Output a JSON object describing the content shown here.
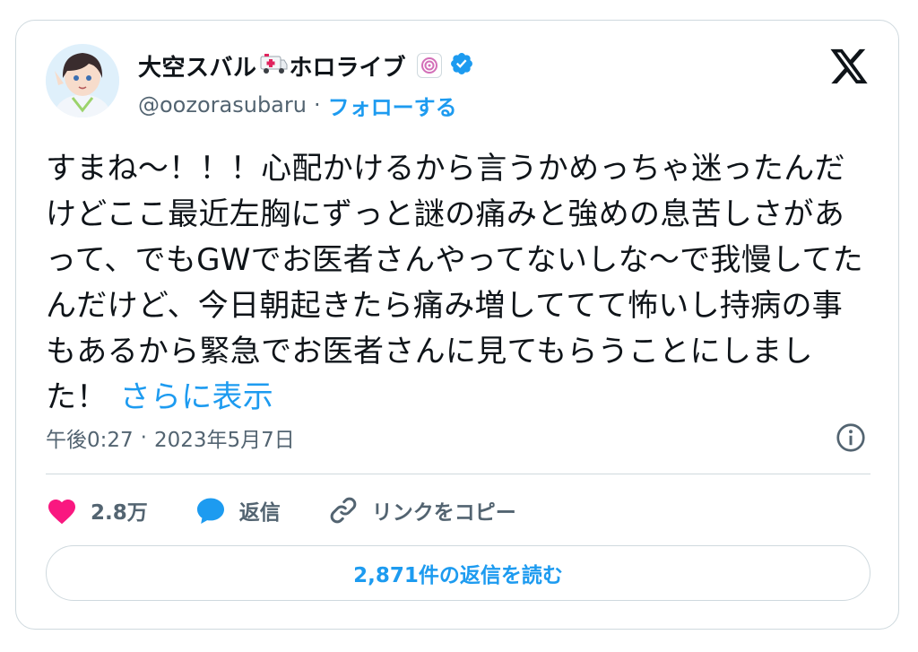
{
  "author": {
    "display_name": "大空スバル",
    "name_suffix": "ホロライブ",
    "handle": "@oozorasubaru",
    "follow_label": "フォローする",
    "separator": "·"
  },
  "tweet": {
    "text": "すまね〜！！！心配かけるから言うかめっちゃ迷ったんだけどここ最近左胸にずっと謎の痛みと強めの息苦しさがあって、でもGWでお医者さんやってないしな〜で我慢してたんだけど、今日朝起きたら痛み増しててて怖いし持病の事もあるから緊急でお医者さんに見てもらうことにしました！",
    "show_more_label": "さらに表示",
    "time": "午後0:27",
    "separator": "·",
    "date": "2023年5月7日"
  },
  "actions": {
    "likes_count": "2.8万",
    "reply_label": "返信",
    "copy_link_label": "リンクをコピー"
  },
  "read_replies_label": "2,871件の返信を読む",
  "colors": {
    "accent": "#1d9bf0",
    "heart": "#f91880",
    "text": "#0f1419",
    "muted": "#536471",
    "border": "#cfd9de"
  },
  "icons": [
    "avatar",
    "ambulance-icon",
    "affiliate-badge-icon",
    "verified-icon",
    "x-logo-icon",
    "info-icon",
    "heart-icon",
    "reply-icon",
    "link-icon"
  ]
}
